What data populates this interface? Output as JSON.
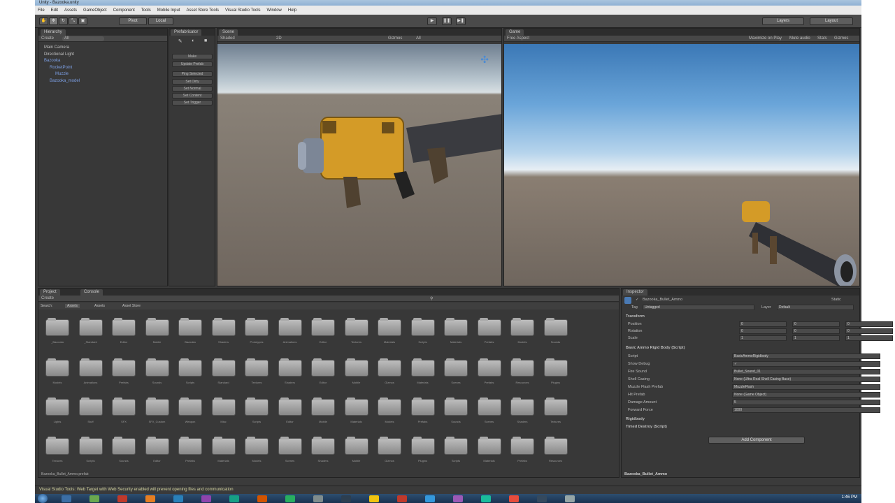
{
  "window_title": "Unity - Bazooka.unity",
  "menu": [
    "File",
    "Edit",
    "Assets",
    "GameObject",
    "Component",
    "Tools",
    "Mobile Input",
    "Asset Store Tools",
    "Visual Studio Tools",
    "Window",
    "Help"
  ],
  "toolbar": {
    "pivot": "Pivot",
    "local": "Local",
    "layers": "Layers",
    "layout": "Layout"
  },
  "hierarchy": {
    "tab": "Hierarchy",
    "create": "Create",
    "search": "All",
    "items": [
      {
        "label": "Main Camera",
        "indent": 0,
        "sel": false
      },
      {
        "label": "Directional Light",
        "indent": 0,
        "sel": false
      },
      {
        "label": "Bazooka",
        "indent": 0,
        "sel": true
      },
      {
        "label": "RocketPoint",
        "indent": 1,
        "sel": true
      },
      {
        "label": "Muzzle",
        "indent": 2,
        "sel": true
      },
      {
        "label": "Bazooka_model",
        "indent": 1,
        "sel": true
      }
    ]
  },
  "prefabs_panel": {
    "tab": "Prefabricator",
    "buttons": [
      "Make",
      "Update Prefab",
      "Ping Selected",
      "Set Dirty",
      "Set Normal",
      "Set Content",
      "Set Trigger"
    ]
  },
  "scene": {
    "tab": "Scene",
    "shading": "Shaded",
    "mode": "2D",
    "gizmos": "Gizmos",
    "search": "All"
  },
  "game": {
    "tab": "Game",
    "aspect": "Free Aspect",
    "options": [
      "Maximize on Play",
      "Mute audio",
      "Stats",
      "Gizmos"
    ]
  },
  "project": {
    "tabs": [
      "Project",
      "Console"
    ],
    "create": "Create",
    "filters": [
      "Search:",
      "Assets",
      "Assets",
      "Asset Store"
    ],
    "folder_rows": [
      [
        "_Bazooka",
        "_Standard",
        "Editor",
        "Mobile",
        "Bazooka",
        "Shaders",
        "Prototypes",
        "Animations",
        "Editor",
        "Textures",
        "Materials",
        "Scripts",
        "Materials",
        "Prefabs",
        "Models",
        "Sounds"
      ],
      [
        "Models",
        "Animations",
        "Prefabs",
        "Sounds",
        "Scripts",
        "Standard",
        "Textures",
        "Shaders",
        "Editor",
        "Mobile",
        "Gizmos",
        "Materials",
        "Scenes",
        "Prefabs",
        "Resources",
        "Plugins"
      ],
      [
        "Lights",
        "Stuff",
        "SFX",
        "SFX_Custom",
        "Weapon",
        "Misc",
        "Scripts",
        "Editor",
        "Mobile",
        "Materials",
        "Models",
        "Prefabs",
        "Sounds",
        "Scenes",
        "Shaders",
        "Textures"
      ],
      [
        "Textures",
        "Scripts",
        "Sounds",
        "Editor",
        "Prefabs",
        "Materials",
        "Models",
        "Scenes",
        "Shaders",
        "Mobile",
        "Gizmos",
        "Plugins",
        "Scripts",
        "Materials",
        "Prefabs",
        "Resources"
      ]
    ],
    "footer": "Bazooka_Bullet_Ammo.prefab"
  },
  "inspector": {
    "tab": "Inspector",
    "object_name": "Bazooka_Bullet_Ammo",
    "static": "Static",
    "tag_label": "Tag",
    "tag": "Untagged",
    "layer_label": "Layer",
    "layer": "Default",
    "transform": "Transform",
    "transform_rows": [
      {
        "label": "Position",
        "x": "0",
        "y": "0",
        "z": "0"
      },
      {
        "label": "Rotation",
        "x": "0",
        "y": "0",
        "z": "0"
      },
      {
        "label": "Scale",
        "x": "1",
        "y": "1",
        "z": "1"
      }
    ],
    "component": "Basic Ammo Rigid Body (Script)",
    "fields": [
      {
        "label": "Script",
        "value": "BasicAmmoRigidbody"
      },
      {
        "label": "Show Debug",
        "value": "✓"
      },
      {
        "label": "Fire Sound",
        "value": "Bullet_Sound_01"
      },
      {
        "label": "Shell Casing",
        "value": "None (Ultra Real Shell Casing Base)"
      },
      {
        "label": "Muzzle Flash Prefab",
        "value": "MuzzleFlash"
      },
      {
        "label": "Hit Prefab",
        "value": "None (Game Object)"
      },
      {
        "label": "Damage Amount",
        "value": "5"
      },
      {
        "label": "Forward Force",
        "value": "1000"
      }
    ],
    "rigidbody": "Rigidbody",
    "timed": "Timed Destroy (Script)",
    "add_component": "Add Component",
    "footer": "Bazooka_Bullet_Ammo"
  },
  "status": "Visual Studio Tools: Web Target with Web Security enabled will prevent opening files and communication",
  "clock": "1:46 PM"
}
